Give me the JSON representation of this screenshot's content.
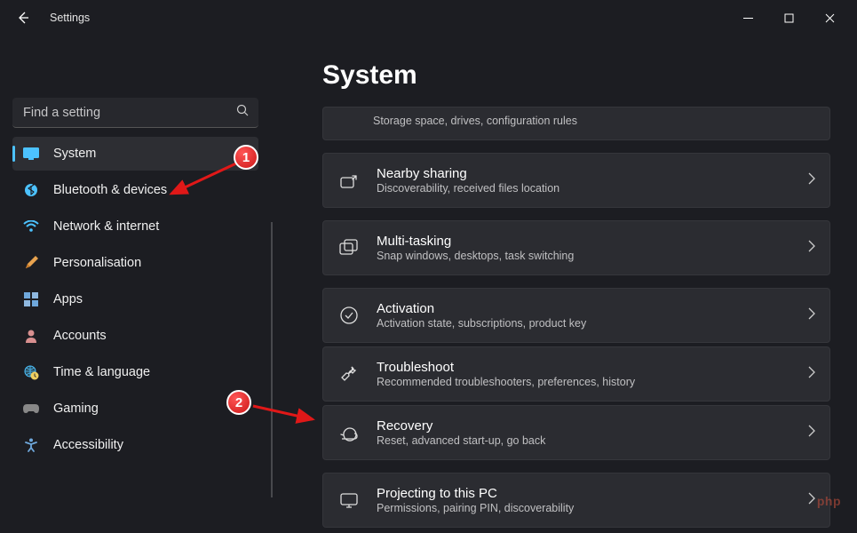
{
  "titlebar": {
    "title": "Settings"
  },
  "search": {
    "placeholder": "Find a setting"
  },
  "sidebar": {
    "items": [
      {
        "label": "System",
        "icon": "display-icon",
        "color": "#4cc2ff",
        "active": true
      },
      {
        "label": "Bluetooth & devices",
        "icon": "bluetooth-icon",
        "color": "#4cc2ff"
      },
      {
        "label": "Network & internet",
        "icon": "wifi-icon",
        "color": "#4cc2ff"
      },
      {
        "label": "Personalisation",
        "icon": "brush-icon",
        "color": "#e8a34f"
      },
      {
        "label": "Apps",
        "icon": "apps-icon",
        "color": "#6fa8dc"
      },
      {
        "label": "Accounts",
        "icon": "person-icon",
        "color": "#d88f8f"
      },
      {
        "label": "Time & language",
        "icon": "globe-clock-icon",
        "color": "#4cc2ff"
      },
      {
        "label": "Gaming",
        "icon": "gaming-icon",
        "color": "#888"
      },
      {
        "label": "Accessibility",
        "icon": "accessibility-icon",
        "color": "#6fa8dc"
      }
    ]
  },
  "main": {
    "title": "System",
    "truncated_card": {
      "desc": "Storage space, drives, configuration rules"
    },
    "cards": [
      {
        "title": "Nearby sharing",
        "desc": "Discoverability, received files location",
        "icon": "share-icon"
      },
      {
        "title": "Multi-tasking",
        "desc": "Snap windows, desktops, task switching",
        "icon": "multitask-icon"
      },
      {
        "title": "Activation",
        "desc": "Activation state, subscriptions, product key",
        "icon": "check-circle-icon"
      },
      {
        "title": "Troubleshoot",
        "desc": "Recommended troubleshooters, preferences, history",
        "icon": "wrench-icon"
      },
      {
        "title": "Recovery",
        "desc": "Reset, advanced start-up, go back",
        "icon": "recovery-icon"
      },
      {
        "title": "Projecting to this PC",
        "desc": "Permissions, pairing PIN, discoverability",
        "icon": "project-icon"
      }
    ]
  },
  "callouts": {
    "one": "1",
    "two": "2"
  },
  "watermark": "php"
}
